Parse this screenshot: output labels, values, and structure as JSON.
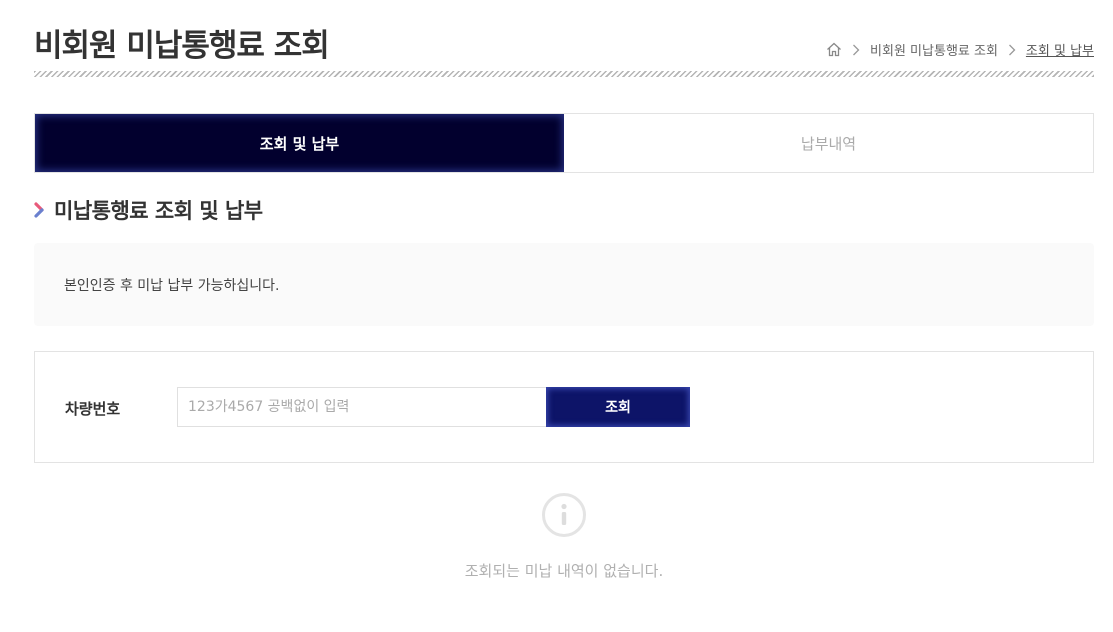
{
  "page": {
    "title": "비회원 미납통행료 조회"
  },
  "breadcrumb": {
    "home_icon": "home-icon",
    "items": [
      "비회원 미납통행료 조회",
      "조회 및 납부"
    ]
  },
  "tabs": [
    {
      "label": "조회 및 납부",
      "active": true
    },
    {
      "label": "납부내역",
      "active": false
    }
  ],
  "section": {
    "title": "미납통행료 조회 및 납부"
  },
  "notice": {
    "text": "본인인증 후 미납 납부 가능하십니다."
  },
  "search": {
    "label": "차량번호",
    "placeholder": "123가4567 공백없이 입력",
    "value": "",
    "button_label": "조회"
  },
  "empty_state": {
    "icon": "info-icon",
    "message": "조회되는 미납 내역이 없습니다."
  },
  "colors": {
    "tab_active_bg": "#02002e",
    "button_bg": "#0d1468",
    "chevron_pink": "#e85a7a",
    "chevron_blue": "#6a80cf"
  }
}
